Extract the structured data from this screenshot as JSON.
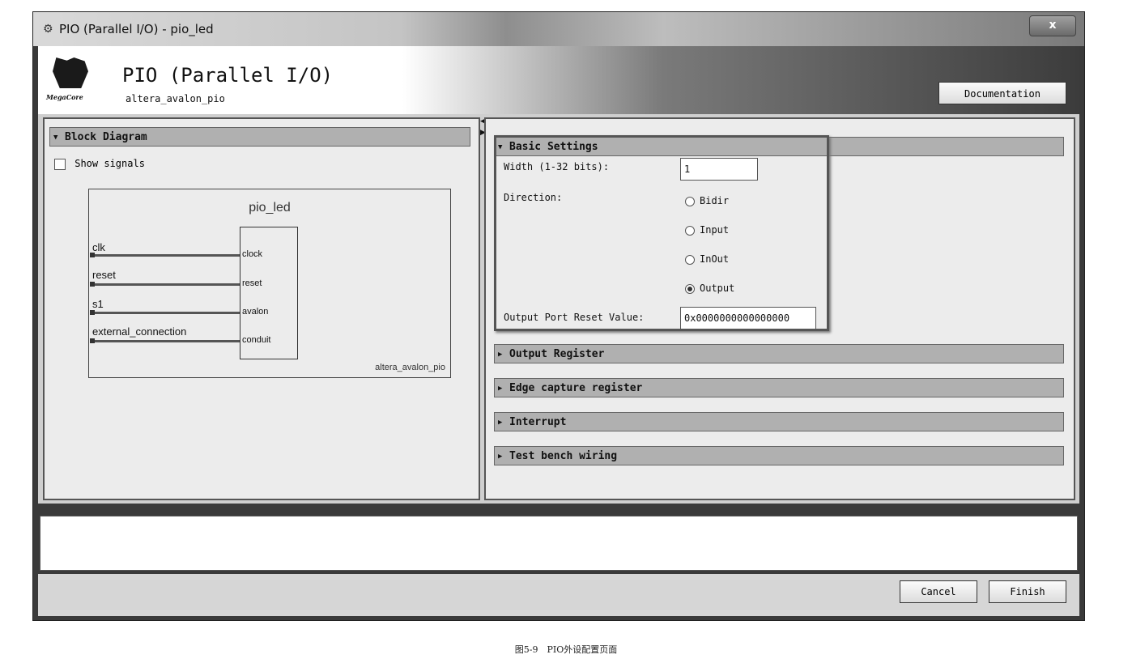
{
  "window": {
    "title": "PIO (Parallel I/O) - pio_led",
    "close_label": "x"
  },
  "header": {
    "logo_text": "MegaCore",
    "title": "PIO (Parallel I/O)",
    "subtitle": "altera_avalon_pio",
    "documentation_label": "Documentation"
  },
  "left": {
    "section_title": "Block Diagram",
    "show_signals_label": "Show signals",
    "show_signals_checked": false,
    "diagram": {
      "title": "pio_led",
      "footer": "altera_avalon_pio",
      "signals": [
        "clk",
        "reset",
        "s1",
        "external_connection"
      ],
      "ports": [
        "clock",
        "reset",
        "avalon",
        "conduit"
      ]
    }
  },
  "right": {
    "basic": {
      "title": "Basic Settings",
      "width_label": "Width (1-32 bits):",
      "width_value": "1",
      "direction_label": "Direction:",
      "directions": [
        {
          "label": "Bidir",
          "selected": false
        },
        {
          "label": "Input",
          "selected": false
        },
        {
          "label": "InOut",
          "selected": false
        },
        {
          "label": "Output",
          "selected": true
        }
      ],
      "reset_label": "Output Port Reset Value:",
      "reset_value": "0x0000000000000000"
    },
    "sections": [
      "Output Register",
      "Edge capture register",
      "Interrupt",
      "Test bench wiring"
    ]
  },
  "footer": {
    "cancel_label": "Cancel",
    "finish_label": "Finish"
  },
  "caption": "图5-9　PIO外设配置页面"
}
